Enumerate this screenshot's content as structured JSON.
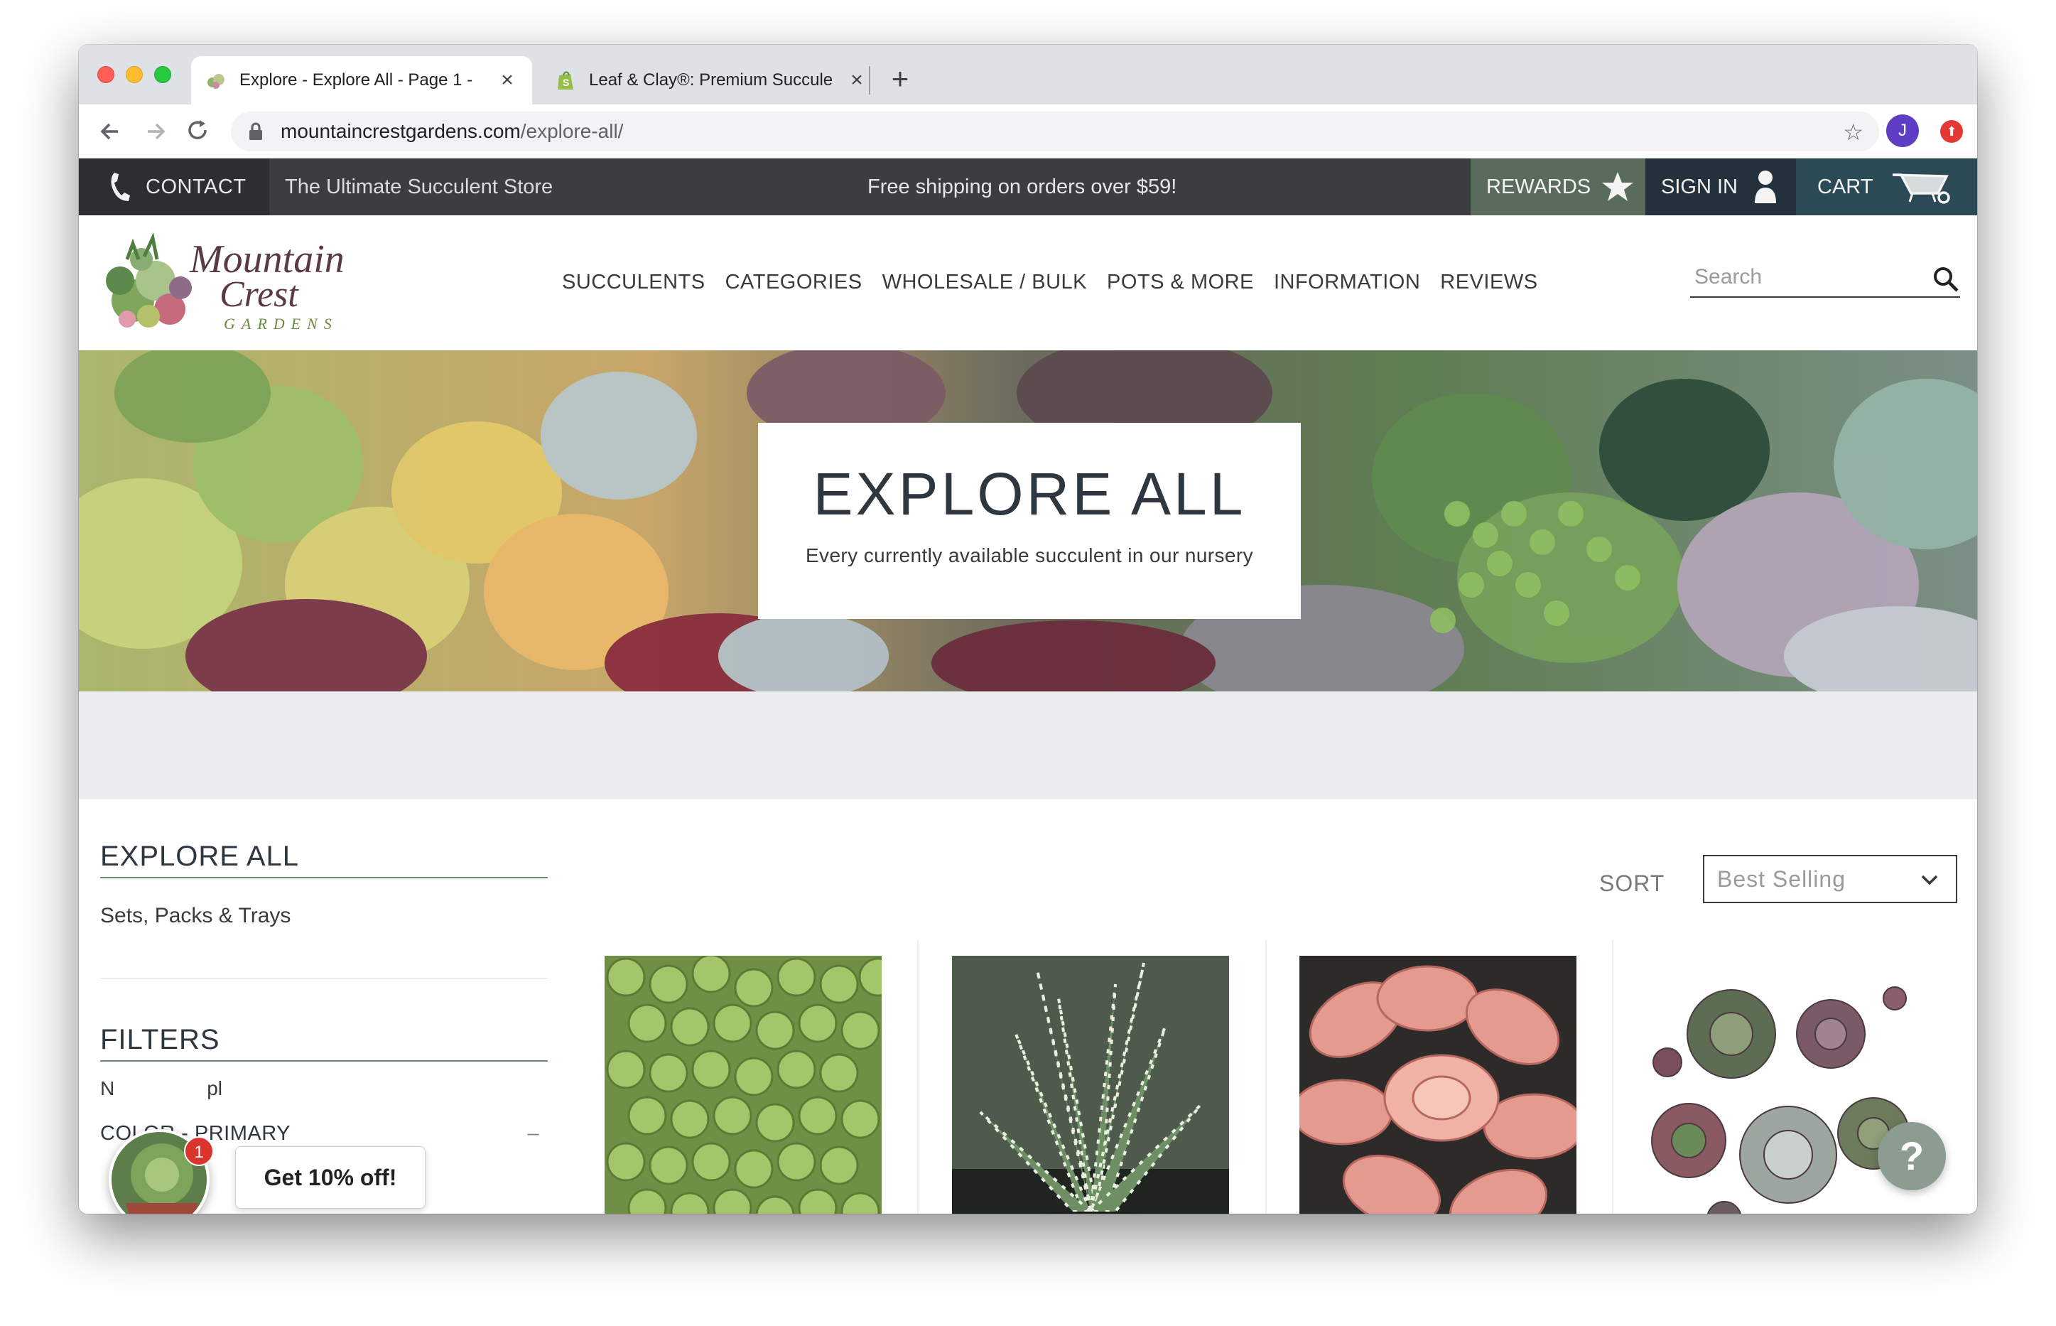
{
  "browser": {
    "tabs": [
      {
        "title": "Explore - Explore All - Page 1 -",
        "active": true,
        "favicon": "succulent-favicon"
      },
      {
        "title": "Leaf & Clay®: Premium Succule",
        "active": false,
        "favicon": "shopify-favicon"
      }
    ],
    "url_host": "mountaincrestgardens.com",
    "url_path": "/explore-all/",
    "profile_initial": "J"
  },
  "topbar": {
    "contact": "CONTACT",
    "tagline": "The Ultimate Succulent Store",
    "shipping": "Free shipping on orders over $59!",
    "rewards": "REWARDS",
    "sign_in": "SIGN IN",
    "cart": "CART"
  },
  "header": {
    "logo_line1": "Mountain",
    "logo_line2": "Crest",
    "logo_line3": "GARDENS",
    "nav": [
      "SUCCULENTS",
      "CATEGORIES",
      "WHOLESALE / BULK",
      "POTS & MORE",
      "INFORMATION",
      "REVIEWS"
    ],
    "search_placeholder": "Search"
  },
  "hero": {
    "title": "EXPLORE ALL",
    "subtitle": "Every currently available succulent in our nursery"
  },
  "sidebar": {
    "heading": "EXPLORE ALL",
    "link": "Sets, Packs & Trays",
    "filters_heading": "FILTERS",
    "filter_sub": "N",
    "filter_sub_tail": "pl",
    "color_filter": "COLOR - PRIMARY",
    "collapse": "–"
  },
  "promo": {
    "badge_count": "1",
    "text": "Get 10% off!"
  },
  "sort": {
    "label": "SORT",
    "selected": "Best Selling"
  },
  "help": {
    "label": "?"
  },
  "colors": {
    "topbar": "#3b3d40",
    "contact_bg": "#2c2e31",
    "rewards_bg": "#596c5b",
    "signin_bg": "#23313c",
    "cart_bg": "#2b4a55",
    "accent_green": "#6f8a70",
    "band": "#ebecef"
  }
}
